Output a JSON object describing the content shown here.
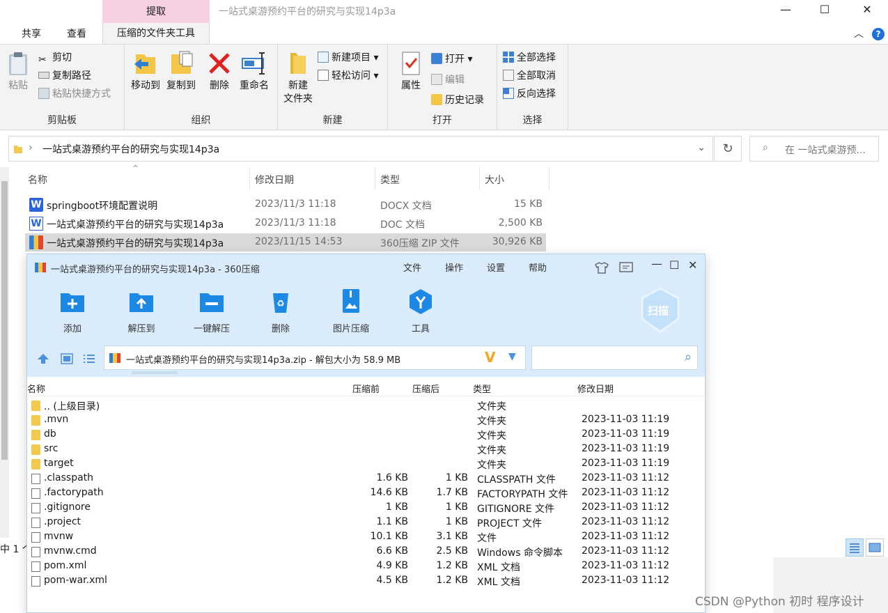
{
  "explorer": {
    "title": "一站式桌游预约平台的研究与实现14p3a",
    "context_tab_header": "提取",
    "tabs": [
      "共享",
      "查看",
      "压缩的文件夹工具"
    ],
    "window_controls": [
      "—",
      "☐",
      "✕"
    ],
    "ribbon": {
      "clipboard": {
        "label": "剪贴板",
        "paste": "粘贴",
        "cut": "剪切",
        "copy_path": "复制路径",
        "paste_shortcut": "粘贴快捷方式"
      },
      "organize": {
        "label": "组织",
        "move_to": "移动到",
        "copy_to": "复制到",
        "delete": "删除",
        "rename": "重命名"
      },
      "new": {
        "label": "新建",
        "new_folder_l1": "新建",
        "new_folder_l2": "文件夹",
        "new_item": "新建项目",
        "easy_access": "轻松访问"
      },
      "open": {
        "label": "打开",
        "properties": "属性",
        "open": "打开",
        "edit": "编辑",
        "history": "历史记录"
      },
      "select": {
        "label": "选择",
        "select_all": "全部选择",
        "select_none": "全部取消",
        "invert": "反向选择"
      }
    },
    "address": "一站式桌游预约平台的研究与实现14p3a",
    "search_placeholder": "在 一站式桌游预...",
    "columns": {
      "name": "名称",
      "date": "修改日期",
      "type": "类型",
      "size": "大小"
    },
    "files": [
      {
        "name": "springboot环境配置说明",
        "date": "2023/11/3 11:18",
        "type": "DOCX 文档",
        "size": "15 KB",
        "icon": "word-docx-icon"
      },
      {
        "name": "一站式桌游预约平台的研究与实现14p3a",
        "date": "2023/11/3 11:18",
        "type": "DOC 文档",
        "size": "2,500 KB",
        "icon": "word-doc-icon"
      },
      {
        "name": "一站式桌游预约平台的研究与实现14p3a",
        "date": "2023/11/15 14:53",
        "type": "360压缩 ZIP 文件",
        "size": "30,926 KB",
        "icon": "zip-archive-icon"
      }
    ],
    "status_count": "中 1 个"
  },
  "zip": {
    "title": "一站式桌游预约平台的研究与实现14p3a - 360压缩",
    "menu": [
      "文件",
      "操作",
      "设置",
      "帮助"
    ],
    "tools": [
      "添加",
      "解压到",
      "一键解压",
      "删除",
      "图片压缩",
      "工具"
    ],
    "scan_label": "扫描",
    "path": "一站式桌游预约平台的研究与实现14p3a.zip - 解包大小为 58.9 MB",
    "columns": {
      "name": "名称",
      "before": "压缩前",
      "after": "压缩后",
      "type": "类型",
      "date": "修改日期"
    },
    "rows": [
      {
        "name": ".. (上级目录)",
        "before": "",
        "after": "",
        "type": "文件夹",
        "date": "",
        "kind": "folder"
      },
      {
        "name": ".mvn",
        "before": "",
        "after": "",
        "type": "文件夹",
        "date": "2023-11-03 11:19",
        "kind": "folder"
      },
      {
        "name": "db",
        "before": "",
        "after": "",
        "type": "文件夹",
        "date": "2023-11-03 11:19",
        "kind": "folder"
      },
      {
        "name": "src",
        "before": "",
        "after": "",
        "type": "文件夹",
        "date": "2023-11-03 11:19",
        "kind": "folder"
      },
      {
        "name": "target",
        "before": "",
        "after": "",
        "type": "文件夹",
        "date": "2023-11-03 11:19",
        "kind": "folder"
      },
      {
        "name": ".classpath",
        "before": "1.6 KB",
        "after": "1 KB",
        "type": "CLASSPATH 文件",
        "date": "2023-11-03 11:12",
        "kind": "file"
      },
      {
        "name": ".factorypath",
        "before": "14.6 KB",
        "after": "1.7 KB",
        "type": "FACTORYPATH 文件",
        "date": "2023-11-03 11:12",
        "kind": "file"
      },
      {
        "name": ".gitignore",
        "before": "1 KB",
        "after": "1 KB",
        "type": "GITIGNORE 文件",
        "date": "2023-11-03 11:12",
        "kind": "file"
      },
      {
        "name": ".project",
        "before": "1.1 KB",
        "after": "1 KB",
        "type": "PROJECT 文件",
        "date": "2023-11-03 11:12",
        "kind": "file"
      },
      {
        "name": "mvnw",
        "before": "10.1 KB",
        "after": "3.1 KB",
        "type": "文件",
        "date": "2023-11-03 11:12",
        "kind": "file"
      },
      {
        "name": "mvnw.cmd",
        "before": "6.6 KB",
        "after": "2.5 KB",
        "type": "Windows 命令脚本",
        "date": "2023-11-03 11:12",
        "kind": "cmd"
      },
      {
        "name": "pom.xml",
        "before": "4.9 KB",
        "after": "1.2 KB",
        "type": "XML 文档",
        "date": "2023-11-03 11:12",
        "kind": "xml"
      },
      {
        "name": "pom-war.xml",
        "before": "4.5 KB",
        "after": "1.2 KB",
        "type": "XML 文档",
        "date": "2023-11-03 11:12",
        "kind": "xml"
      }
    ]
  },
  "watermark": "CSDN @Python 初时 程序设计",
  "colors": {
    "context_tab": "#f7d1e3",
    "accent": "#1f6fd8",
    "zip_chrome": "#daecfc",
    "selection": "#d9d9d9"
  }
}
